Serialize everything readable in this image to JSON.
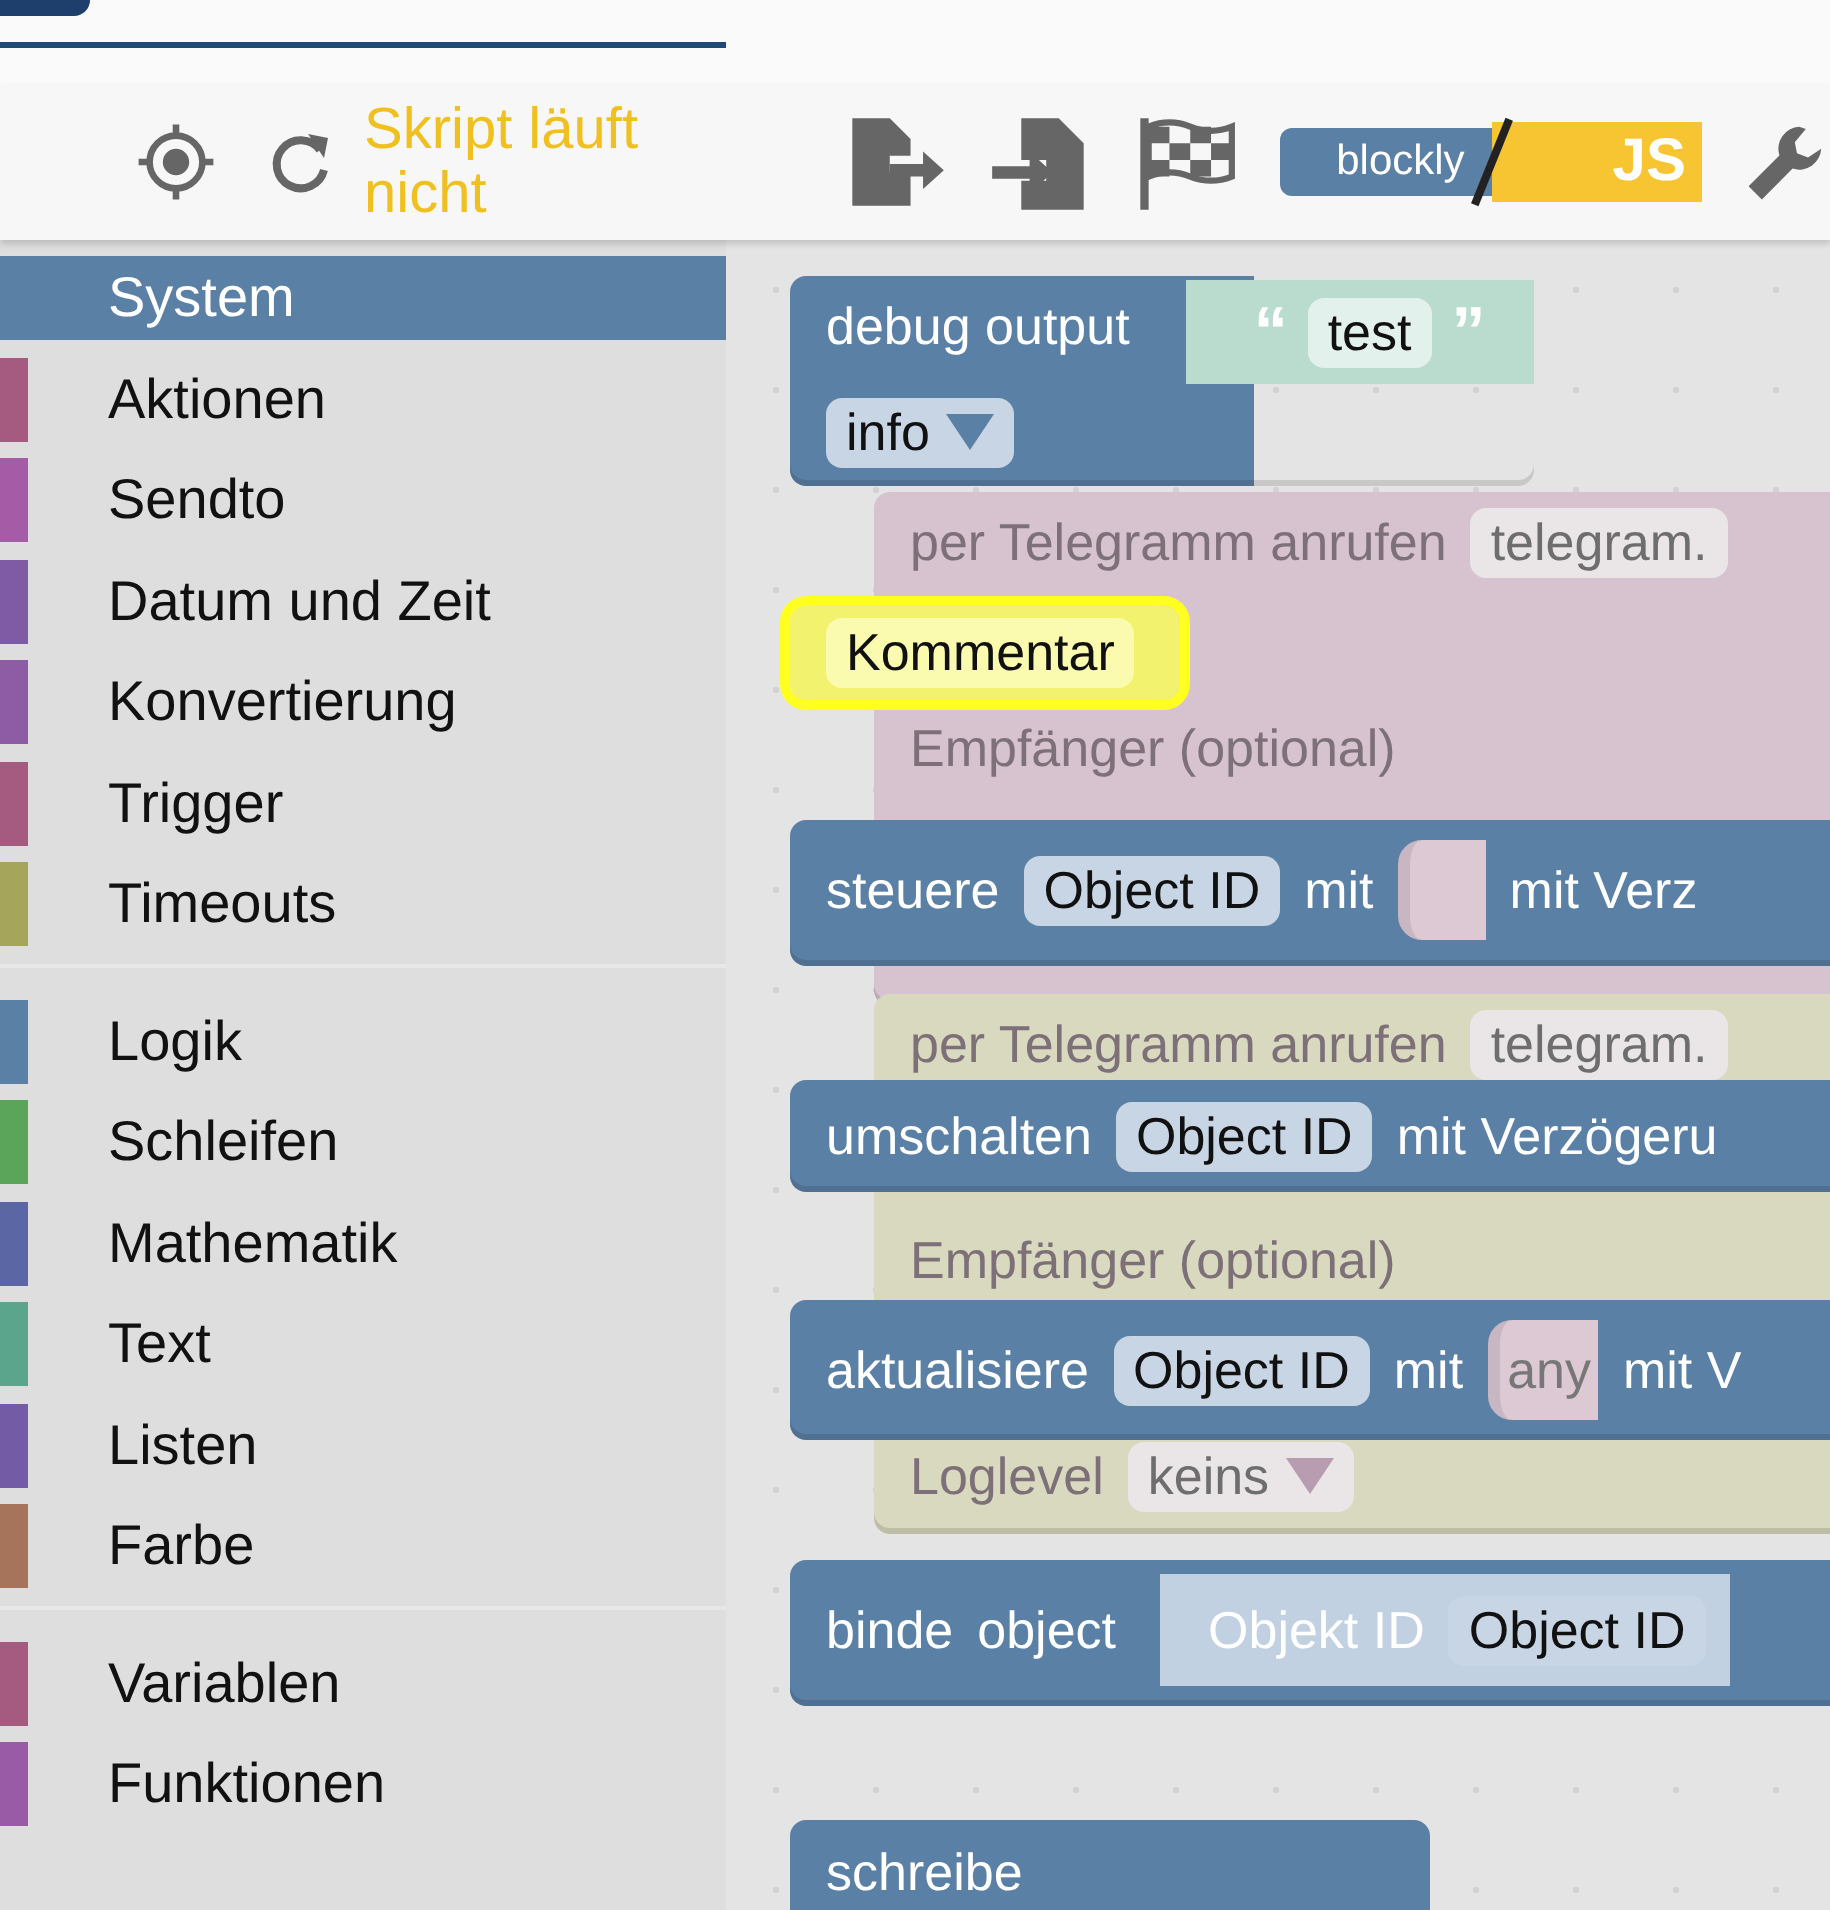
{
  "toolbar": {
    "status": "Skript läuft nicht",
    "mode_toggle": {
      "left": "blockly",
      "right": "JS"
    }
  },
  "categories": [
    [
      {
        "label": "System",
        "color": "#5b80a5",
        "selected": true
      },
      {
        "label": "Aktionen",
        "color": "#a55b80",
        "selected": false
      },
      {
        "label": "Sendto",
        "color": "#a55ba5",
        "selected": false
      },
      {
        "label": "Datum und Zeit",
        "color": "#805ba5",
        "selected": false
      },
      {
        "label": "Konvertierung",
        "color": "#8e5ba5",
        "selected": false
      },
      {
        "label": "Trigger",
        "color": "#a55b80",
        "selected": false
      },
      {
        "label": "Timeouts",
        "color": "#a5a55b",
        "selected": false
      }
    ],
    [
      {
        "label": "Logik",
        "color": "#5b80a5",
        "selected": false
      },
      {
        "label": "Schleifen",
        "color": "#5ba55b",
        "selected": false
      },
      {
        "label": "Mathematik",
        "color": "#5b67a5",
        "selected": false
      },
      {
        "label": "Text",
        "color": "#5ba58c",
        "selected": false
      },
      {
        "label": "Listen",
        "color": "#745ba5",
        "selected": false
      },
      {
        "label": "Farbe",
        "color": "#a5745b",
        "selected": false
      }
    ],
    [
      {
        "label": "Variablen",
        "color": "#a55b80",
        "selected": false
      },
      {
        "label": "Funktionen",
        "color": "#995ba5",
        "selected": false
      }
    ]
  ],
  "blocks": [
    {
      "color": "#5b80a5",
      "disabled": false,
      "selected": false,
      "rows": [
        [
          {
            "kind": "text",
            "text": "debug output"
          },
          {
            "kind": "string",
            "open": "“",
            "value": "test",
            "close": "”"
          }
        ],
        [
          {
            "kind": "dropdown",
            "value": "info"
          }
        ]
      ]
    },
    {
      "color": "#d6c3cf",
      "disabled": true,
      "selected": false,
      "rows": [
        [
          {
            "kind": "text",
            "text": "per Telegramm anrufen"
          },
          {
            "kind": "field",
            "value": "telegram."
          }
        ],
        [
          {
            "kind": "text",
            "text": "Empfänger (optional)"
          }
        ]
      ]
    },
    {
      "color": "#f2f26e",
      "disabled": false,
      "selected": true,
      "rows": [
        [
          {
            "kind": "field",
            "value": "Kommentar"
          }
        ]
      ]
    },
    {
      "color": "#5b80a5",
      "disabled": false,
      "selected": false,
      "rows": [
        [
          {
            "kind": "text",
            "text": "steuere"
          },
          {
            "kind": "field",
            "value": "Object ID"
          },
          {
            "kind": "text",
            "text": "mit"
          },
          {
            "kind": "socket"
          },
          {
            "kind": "text",
            "text": "mit Verz"
          }
        ]
      ]
    },
    {
      "color": "#d9d9bf",
      "disabled": true,
      "selected": false,
      "rows": [
        [
          {
            "kind": "text",
            "text": "per Telegramm anrufen"
          },
          {
            "kind": "field",
            "value": "telegram."
          }
        ],
        [
          {
            "kind": "text",
            "text": "Empfänger (optional)"
          }
        ],
        [
          {
            "kind": "dropdown",
            "label": "Loglevel",
            "value": "keins"
          }
        ]
      ]
    },
    {
      "color": "#5b80a5",
      "disabled": false,
      "selected": false,
      "rows": [
        [
          {
            "kind": "text",
            "text": "umschalten"
          },
          {
            "kind": "field",
            "value": "Object ID"
          },
          {
            "kind": "text",
            "text": "mit Verzögeru"
          }
        ]
      ]
    },
    {
      "color": "#5b80a5",
      "disabled": false,
      "selected": false,
      "rows": [
        [
          {
            "kind": "text",
            "text": "aktualisiere"
          },
          {
            "kind": "field",
            "value": "Object ID"
          },
          {
            "kind": "text",
            "text": "mit"
          },
          {
            "kind": "socket",
            "text": "any"
          },
          {
            "kind": "text",
            "text": "mit V"
          }
        ]
      ]
    },
    {
      "color": "#5b80a5",
      "disabled": false,
      "selected": false,
      "rows": [
        [
          {
            "kind": "text",
            "text": "binde"
          },
          {
            "kind": "text",
            "text": "object"
          },
          {
            "kind": "inner",
            "label": "Objekt ID",
            "value": "Object ID"
          }
        ]
      ]
    },
    {
      "color": "#5b80a5",
      "disabled": false,
      "selected": false,
      "rows": [
        [
          {
            "kind": "text",
            "text": "schreibe"
          }
        ]
      ]
    }
  ]
}
